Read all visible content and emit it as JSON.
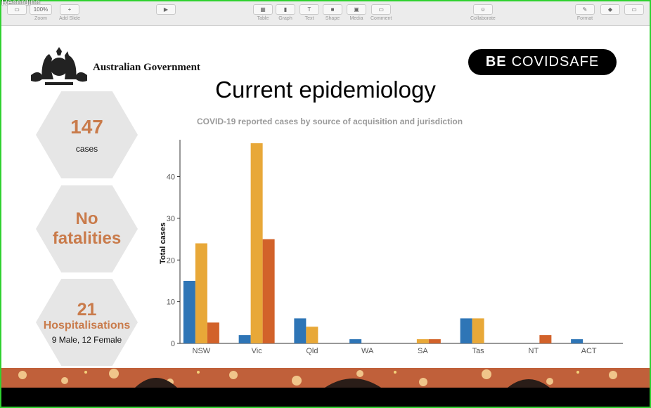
{
  "window": {
    "recording_label": "Recording"
  },
  "toolbar": {
    "zoom_value": "100%",
    "items": [
      {
        "label": "Zoom",
        "icon": "zoom-dropdown"
      },
      {
        "label": "Add Slide",
        "icon": "plus-icon"
      },
      {
        "label": "Table",
        "icon": "table-icon"
      },
      {
        "label": "Graph",
        "icon": "graph-icon"
      },
      {
        "label": "Text",
        "icon": "text-icon"
      },
      {
        "label": "Shape",
        "icon": "shape-icon"
      },
      {
        "label": "Media",
        "icon": "media-icon"
      },
      {
        "label": "Comment",
        "icon": "comment-icon"
      },
      {
        "label": "Collaborate",
        "icon": "collaborate-icon"
      },
      {
        "label": "Format",
        "icon": "format-icon"
      }
    ]
  },
  "slide": {
    "govt_label": "Australian Government",
    "brand_bold": "BE",
    "brand_rest": "COVIDSAFE",
    "title": "Current epidemiology",
    "stats": {
      "cases_value": "147",
      "cases_label": "cases",
      "fatalities_line1": "No",
      "fatalities_line2": "fatalities",
      "hosp_value": "21",
      "hosp_label": "Hospitalisations",
      "hosp_detail": "9 Male, 12 Female"
    }
  },
  "chart_data": {
    "type": "bar",
    "title": "COVID-19 reported cases by source of acquisition and jurisdiction",
    "ylabel": "Total cases",
    "xlabel": "",
    "ylim": [
      0,
      48
    ],
    "yticks": [
      0,
      10,
      20,
      30,
      40
    ],
    "categories": [
      "NSW",
      "Vic",
      "Qld",
      "WA",
      "SA",
      "Tas",
      "NT",
      "ACT"
    ],
    "series": [
      {
        "color": "#2e75b6",
        "values": [
          15,
          2,
          6,
          1,
          0,
          6,
          0,
          1
        ]
      },
      {
        "color": "#e8a838",
        "values": [
          24,
          48,
          4,
          0,
          1,
          6,
          0,
          0
        ]
      },
      {
        "color": "#d2622a",
        "values": [
          5,
          25,
          0,
          0,
          1,
          0,
          2,
          0
        ]
      }
    ]
  }
}
